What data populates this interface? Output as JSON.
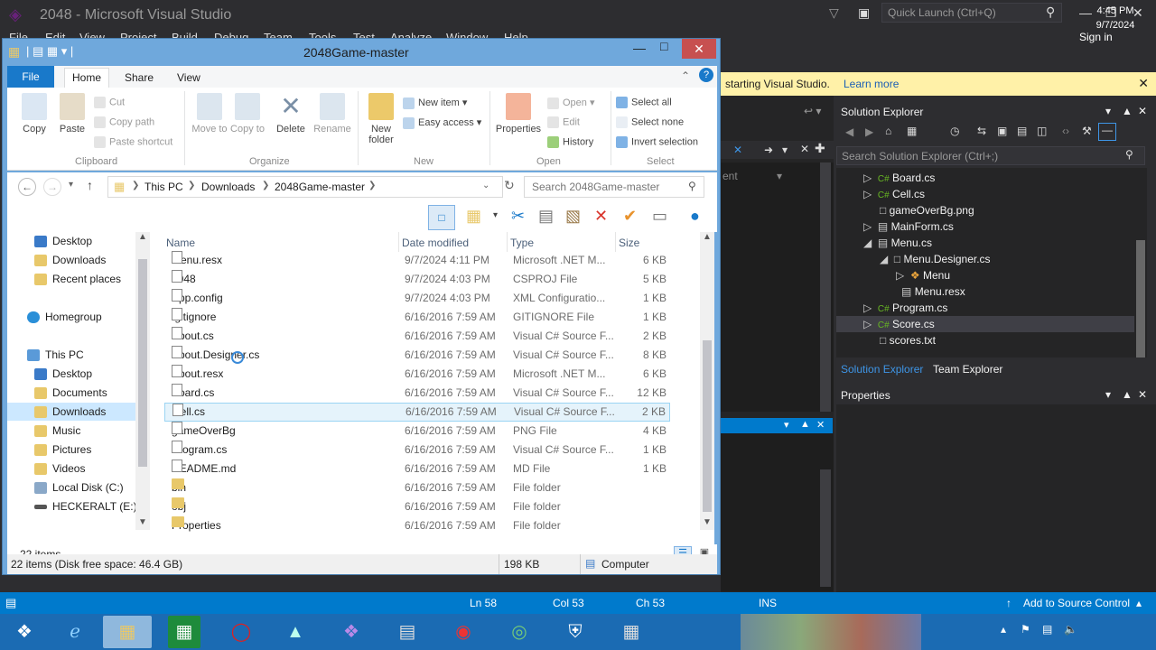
{
  "vs": {
    "title": "2048 - Microsoft Visual Studio",
    "menu": [
      "File",
      "Edit",
      "View",
      "Project",
      "Build",
      "Debug",
      "Team",
      "Tools",
      "Test",
      "Analyze",
      "Window",
      "Help"
    ],
    "quick_launch": "Quick Launch (Ctrl+Q)",
    "sign_in": "Sign in",
    "banner_text": "starting Visual Studio.",
    "banner_link": "Learn more",
    "solution_explorer": {
      "title": "Solution Explorer",
      "search_placeholder": "Search Solution Explorer (Ctrl+;)",
      "items": [
        {
          "label": "Board.cs"
        },
        {
          "label": "Cell.cs"
        },
        {
          "label": "gameOverBg.png"
        },
        {
          "label": "MainForm.cs"
        },
        {
          "label": "Menu.cs"
        },
        {
          "label": "Menu.Designer.cs"
        },
        {
          "label": "Menu"
        },
        {
          "label": "Menu.resx"
        },
        {
          "label": "Program.cs"
        },
        {
          "label": "Score.cs"
        },
        {
          "label": "scores.txt"
        }
      ],
      "tab_solution": "Solution Explorer",
      "tab_team": "Team Explorer"
    },
    "editor_fragment": "ent",
    "properties_title": "Properties",
    "status": {
      "line": "Ln 58",
      "col": "Col 53",
      "ch": "Ch 53",
      "ins": "INS",
      "source_control": "Add to Source Control"
    }
  },
  "explorer": {
    "title": "2048Game-master",
    "tabs": {
      "file": "File",
      "home": "Home",
      "share": "Share",
      "view": "View"
    },
    "ribbon": {
      "copy": "Copy",
      "paste": "Paste",
      "cut": "Cut",
      "copy_path": "Copy path",
      "paste_shortcut": "Paste shortcut",
      "clipboard": "Clipboard",
      "move_to": "Move to",
      "copy_to": "Copy to",
      "delete": "Delete",
      "rename": "Rename",
      "organize": "Organize",
      "new_folder": "New folder",
      "new_item": "New item",
      "easy_access": "Easy access",
      "new": "New",
      "properties": "Properties",
      "open": "Open",
      "edit": "Edit",
      "history": "History",
      "open_group": "Open",
      "select_all": "Select all",
      "select_none": "Select none",
      "invert_selection": "Invert selection",
      "select_group": "Select"
    },
    "path": [
      "This PC",
      "Downloads",
      "2048Game-master"
    ],
    "search_placeholder": "Search 2048Game-master",
    "nav": {
      "desktop_fav": "Desktop",
      "downloads_fav": "Downloads",
      "recent": "Recent places",
      "homegroup": "Homegroup",
      "this_pc": "This PC",
      "desktop": "Desktop",
      "documents": "Documents",
      "downloads": "Downloads",
      "music": "Music",
      "pictures": "Pictures",
      "videos": "Videos",
      "local_disk": "Local Disk (C:)",
      "heckeralt": "HECKERALT (E:)"
    },
    "columns": {
      "name": "Name",
      "date": "Date modified",
      "type": "Type",
      "size": "Size"
    },
    "files": [
      {
        "name": "Menu.resx",
        "date": "9/7/2024 4:11 PM",
        "type": "Microsoft .NET M...",
        "size": "6 KB"
      },
      {
        "name": "2048",
        "date": "9/7/2024 4:03 PM",
        "type": "CSPROJ File",
        "size": "5 KB"
      },
      {
        "name": "App.config",
        "date": "9/7/2024 4:03 PM",
        "type": "XML Configuratio...",
        "size": "1 KB"
      },
      {
        "name": ".gitignore",
        "date": "6/16/2016 7:59 AM",
        "type": "GITIGNORE File",
        "size": "1 KB"
      },
      {
        "name": "About.cs",
        "date": "6/16/2016 7:59 AM",
        "type": "Visual C# Source F...",
        "size": "2 KB"
      },
      {
        "name": "About.Designer.cs",
        "date": "6/16/2016 7:59 AM",
        "type": "Visual C# Source F...",
        "size": "8 KB"
      },
      {
        "name": "About.resx",
        "date": "6/16/2016 7:59 AM",
        "type": "Microsoft .NET M...",
        "size": "6 KB"
      },
      {
        "name": "Board.cs",
        "date": "6/16/2016 7:59 AM",
        "type": "Visual C# Source F...",
        "size": "12 KB"
      },
      {
        "name": "Cell.cs",
        "date": "6/16/2016 7:59 AM",
        "type": "Visual C# Source F...",
        "size": "2 KB"
      },
      {
        "name": "gameOverBg",
        "date": "6/16/2016 7:59 AM",
        "type": "PNG File",
        "size": "4 KB"
      },
      {
        "name": "Program.cs",
        "date": "6/16/2016 7:59 AM",
        "type": "Visual C# Source F...",
        "size": "1 KB"
      },
      {
        "name": "README.md",
        "date": "6/16/2016 7:59 AM",
        "type": "MD File",
        "size": "1 KB"
      },
      {
        "name": "bin",
        "date": "6/16/2016 7:59 AM",
        "type": "File folder",
        "size": ""
      },
      {
        "name": "obj",
        "date": "6/16/2016 7:59 AM",
        "type": "File folder",
        "size": ""
      },
      {
        "name": "Properties",
        "date": "6/16/2016 7:59 AM",
        "type": "File folder",
        "size": ""
      }
    ],
    "item_count": "22 items",
    "status_left": "22 items (Disk free space: 46.4 GB)",
    "status_size": "198 KB",
    "status_location": "Computer"
  },
  "taskbar": {
    "time": "4:45 PM",
    "date": "9/7/2024"
  },
  "colors": {
    "vs_blue": "#007acc",
    "explorer_blue": "#1979ca",
    "selection": "#e5f3fb"
  }
}
